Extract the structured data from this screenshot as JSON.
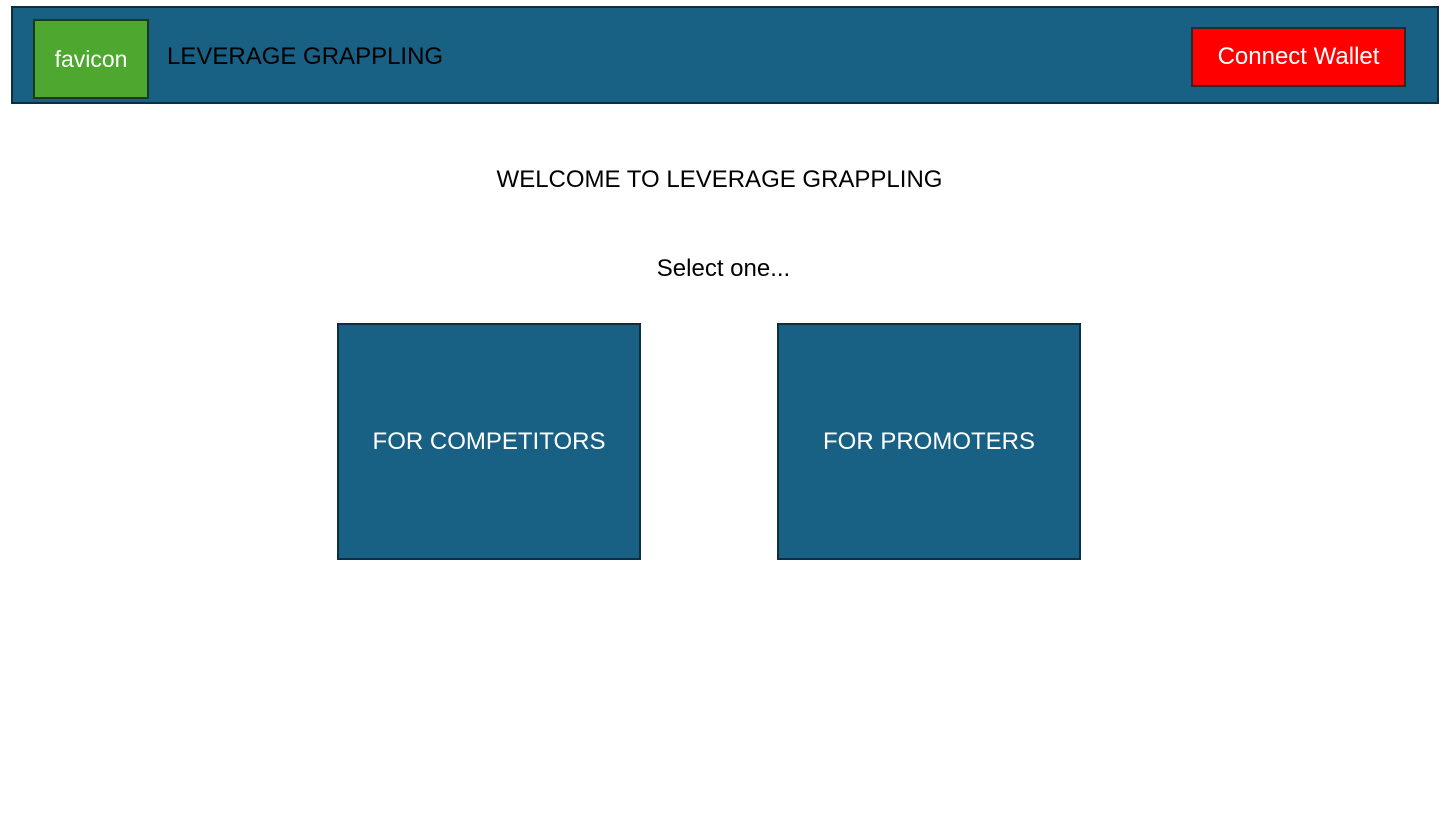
{
  "header": {
    "favicon_label": "favicon",
    "site_title": "LEVERAGE GRAPPLING",
    "connect_wallet_label": "Connect Wallet"
  },
  "main": {
    "welcome_text": "WELCOME TO LEVERAGE GRAPPLING",
    "select_prompt": "Select one...",
    "options": [
      {
        "label": "FOR COMPETITORS"
      },
      {
        "label": "FOR PROMOTERS"
      }
    ]
  },
  "colors": {
    "header_background": "#186084",
    "favicon_background": "#4ea72e",
    "connect_wallet_background": "#ff0000",
    "option_background": "#186084",
    "page_background": "#ffffff"
  }
}
